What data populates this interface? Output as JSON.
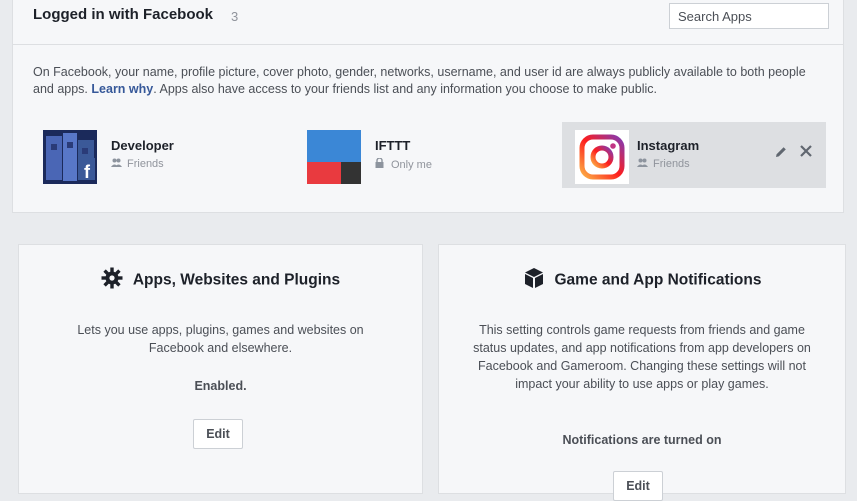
{
  "header": {
    "title": "Logged in with Facebook",
    "count": "3",
    "search_placeholder": "Search Apps"
  },
  "description": {
    "text_before": "On Facebook, your name, profile picture, cover photo, gender, networks, username, and user id are always publicly available to both people and apps.",
    "link": "Learn why",
    "text_after": ". Apps also have access to your friends list and any information you choose to make public."
  },
  "apps": [
    {
      "name": "Developer",
      "audience": "Friends",
      "audience_icon": "friends-icon"
    },
    {
      "name": "IFTTT",
      "audience": "Only me",
      "audience_icon": "lock-icon"
    },
    {
      "name": "Instagram",
      "audience": "Friends",
      "audience_icon": "friends-icon"
    }
  ],
  "cards": [
    {
      "title": "Apps, Websites and Plugins",
      "icon": "gear-icon",
      "body": "Lets you use apps, plugins, games and websites on Facebook and elsewhere.",
      "status": "Enabled.",
      "button": "Edit"
    },
    {
      "title": "Game and App Notifications",
      "icon": "cube-icon",
      "body": "This setting controls game requests from friends and game status updates, and app notifications from app developers on Facebook and Gameroom. Changing these settings will not impact your ability to use apps or play games.",
      "status": "Notifications are turned on",
      "button": "Edit"
    }
  ],
  "colors": {
    "link": "#365899",
    "background": "#e9ebee",
    "panel": "#f6f7f9",
    "selected_row": "#dddfe2"
  }
}
